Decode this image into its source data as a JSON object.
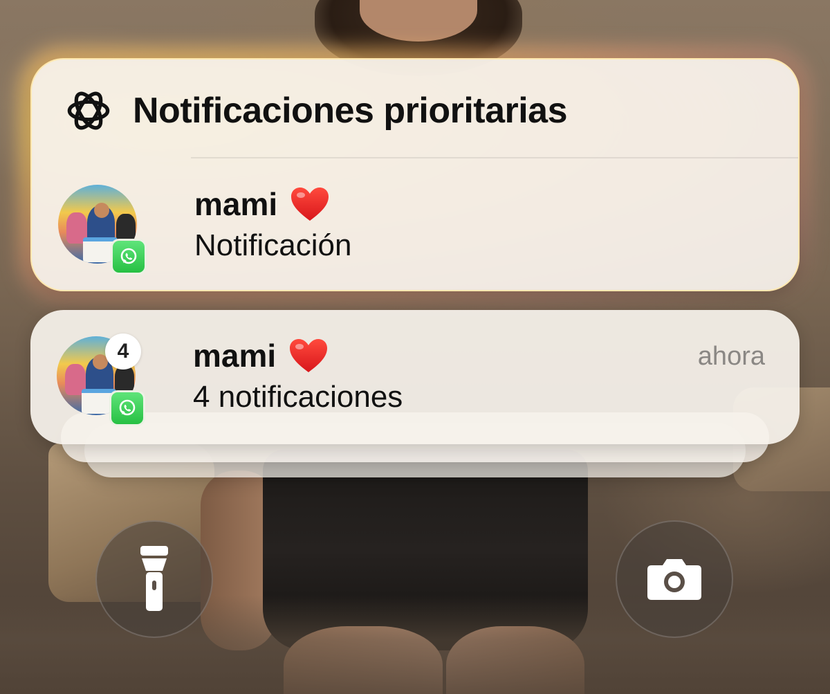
{
  "priority": {
    "icon": "apple-intelligence-icon",
    "title": "Notificaciones prioritarias",
    "notification": {
      "sender": "mami",
      "sender_emoji": "❤️",
      "body": "Notificación",
      "app_icon": "whatsapp-icon"
    }
  },
  "group": {
    "sender": "mami",
    "sender_emoji": "❤️",
    "body": "4 notificaciones",
    "time": "ahora",
    "count": "4",
    "app_icon": "whatsapp-icon"
  },
  "lock_buttons": {
    "left": "flashlight-icon",
    "right": "camera-icon"
  },
  "colors": {
    "glow": "#ffd65a",
    "card": "#f6f2ec",
    "whatsapp": "#27c043",
    "time": "#8a8784"
  }
}
